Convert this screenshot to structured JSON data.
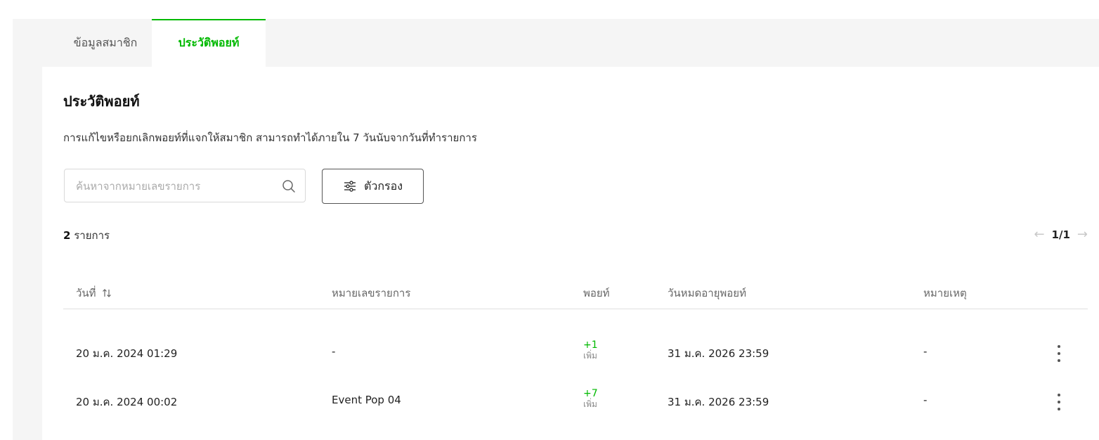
{
  "tabs": [
    {
      "label": "ข้อมูลสมาชิก",
      "active": false
    },
    {
      "label": "ประวัติพอยท์",
      "active": true
    }
  ],
  "page": {
    "title": "ประวัติพอยท์",
    "description": "การแก้ไขหรือยกเลิกพอยท์ที่แจกให้สมาชิก สามารถทำได้ภายใน 7 วันนับจากวันที่ทำรายการ"
  },
  "search": {
    "placeholder": "ค้นหาจากหมายเลขรายการ",
    "value": "",
    "icon": "search-icon"
  },
  "filter": {
    "label": "ตัวกรอง",
    "icon": "sliders-icon"
  },
  "summary": {
    "count": "2",
    "count_label": "รายการ"
  },
  "pagination": {
    "page": "1/1"
  },
  "table": {
    "headers": {
      "date": "วันที่",
      "ref": "หมายเลขรายการ",
      "points": "พอยท์",
      "expiry": "วันหมดอายุพอยท์",
      "note": "หมายเหตุ"
    },
    "rows": [
      {
        "date": "20 ม.ค. 2024 01:29",
        "ref": "-",
        "points": "+1",
        "points_label": "เพิ่ม",
        "expiry": "31 ม.ค. 2026 23:59",
        "note": "-"
      },
      {
        "date": "20 ม.ค. 2024 00:02",
        "ref": "Event Pop 04",
        "points": "+7",
        "points_label": "เพิ่ม",
        "expiry": "31 ม.ค. 2026 23:59",
        "note": "-"
      }
    ]
  },
  "colors": {
    "accent": "#00b900",
    "panel_bg": "#f5f5f5"
  }
}
